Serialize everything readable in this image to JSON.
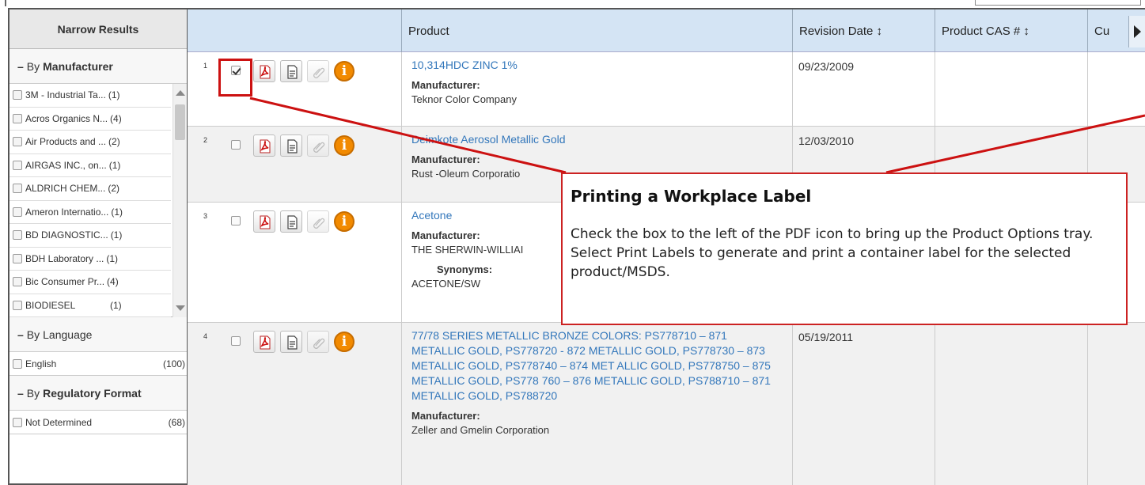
{
  "left_panel": {
    "header": "Narrow Results",
    "by_manufacturer": {
      "prefix": "By",
      "label": "Manufacturer",
      "items": [
        {
          "name": "3M - Industrial Ta...",
          "count": "(1)"
        },
        {
          "name": "Acros Organics N...",
          "count": "(4)"
        },
        {
          "name": "Air Products and ...",
          "count": "(2)"
        },
        {
          "name": "AIRGAS INC., on...",
          "count": "(1)"
        },
        {
          "name": "ALDRICH CHEM...",
          "count": "(2)"
        },
        {
          "name": "Ameron Internatio...",
          "count": "(1)"
        },
        {
          "name": "BD DIAGNOSTIC...",
          "count": "(1)"
        },
        {
          "name": "BDH Laboratory ...",
          "count": "(1)"
        },
        {
          "name": "Bic Consumer Pr...",
          "count": "(4)"
        },
        {
          "name": "BIODIESEL",
          "count": "(1)"
        }
      ]
    },
    "by_language": {
      "prefix": "By",
      "label": "Language",
      "items": [
        {
          "name": "English",
          "count": "(100)"
        }
      ]
    },
    "by_regulatory_format": {
      "prefix": "By",
      "label": "Regulatory Format",
      "items": [
        {
          "name": "Not Determined",
          "count": "(68)"
        }
      ]
    }
  },
  "table": {
    "columns": {
      "product": "Product",
      "revision_date": "Revision Date ↕",
      "product_cas": "Product CAS # ↕",
      "cut": "Cu"
    },
    "rows": [
      {
        "num": "1",
        "checked": true,
        "product": "10,314HDC ZINC 1%",
        "manufacturer_label": "Manufacturer:",
        "manufacturer": "Teknor Color Company",
        "revision_date": "09/23/2009"
      },
      {
        "num": "2",
        "checked": false,
        "product": "Deimkote Aerosol Metallic Gold",
        "manufacturer_label": "Manufacturer:",
        "manufacturer": "Rust -Oleum Corporatio",
        "revision_date": "12/03/2010"
      },
      {
        "num": "3",
        "checked": false,
        "product": "Acetone",
        "manufacturer_label": "Manufacturer:",
        "manufacturer": "THE SHERWIN-WILLIAI",
        "synonyms_label": "Synonyms:",
        "synonyms": "ACETONE/SW",
        "revision_date": ""
      },
      {
        "num": "4",
        "checked": false,
        "product": "77/78 SERIES METALLIC BRONZE COLORS: PS778710 – 871 METALLIC GOLD, PS778720 - 872 METALLIC GOLD, PS778730 – 873 METALLIC GOLD, PS778740 – 874 MET ALLIC GOLD, PS778750 – 875 METALLIC GOLD, PS778 760 – 876 METALLIC GOLD, PS788710 – 871 METALLIC GOLD, PS788720",
        "manufacturer_label": "Manufacturer:",
        "manufacturer": "Zeller and Gmelin Corporation",
        "revision_date": "05/19/2011"
      }
    ]
  },
  "callout": {
    "title": "Printing a Workplace Label",
    "text": "Check the box to the left of the PDF icon to bring up the Product Options tray. Select Print Labels to generate and print a container label for the selected product/MSDS."
  },
  "colors": {
    "link": "#3377bb",
    "header_bg": "#d4e4f4",
    "callout_border": "#cc2222",
    "info_icon": "#f28a00"
  }
}
